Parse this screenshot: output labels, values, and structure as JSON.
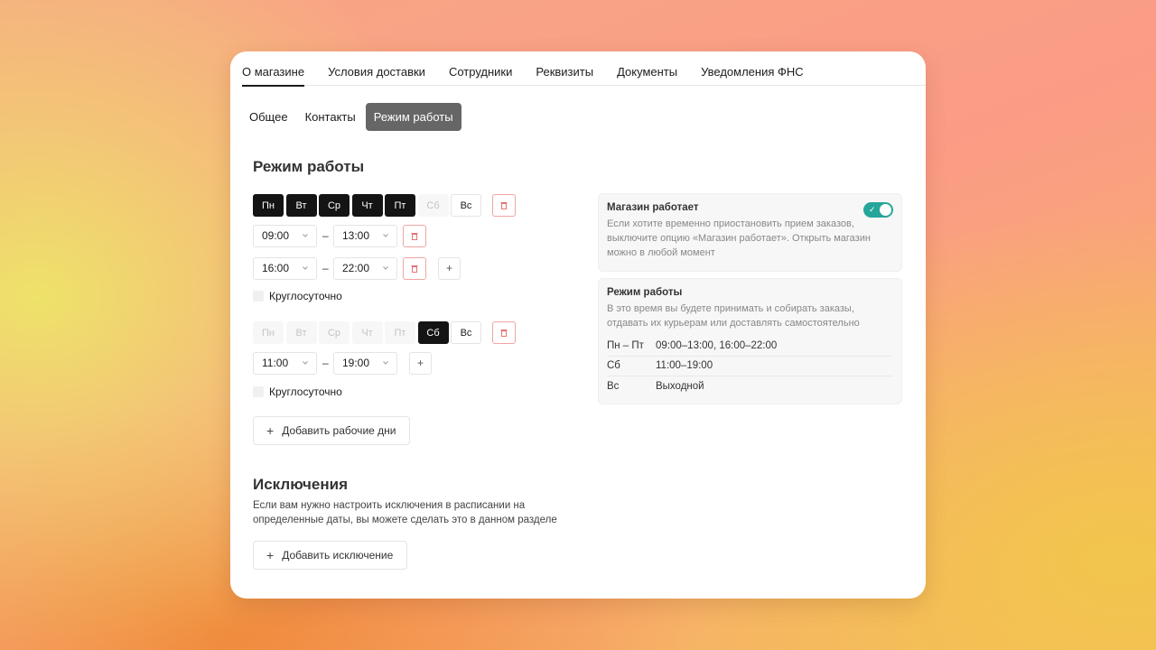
{
  "tabs": [
    "О магазине",
    "Условия доставки",
    "Сотрудники",
    "Реквизиты",
    "Документы",
    "Уведомления ФНС"
  ],
  "subtabs": [
    "Общее",
    "Контакты",
    "Режим работы"
  ],
  "section_title": "Режим работы",
  "group1": {
    "days": [
      "Пн",
      "Вт",
      "Ср",
      "Чт",
      "Пт",
      "Сб",
      "Вс"
    ],
    "intervals": [
      {
        "from": "09:00",
        "to": "13:00"
      },
      {
        "from": "16:00",
        "to": "22:00"
      }
    ],
    "all_day_label": "Круглосуточно"
  },
  "group2": {
    "days": [
      "Пн",
      "Вт",
      "Ср",
      "Чт",
      "Пт",
      "Сб",
      "Вс"
    ],
    "intervals": [
      {
        "from": "11:00",
        "to": "19:00"
      }
    ],
    "all_day_label": "Круглосуточно"
  },
  "dash": "–",
  "plus_symbol": "+",
  "add_days_label": "Добавить рабочие дни",
  "exceptions": {
    "title": "Исключения",
    "description": "Если вам нужно настроить исключения в расписании на определенные даты, вы можете сделать это в данном разделе",
    "add_label": "Добавить исключение"
  },
  "store_status": {
    "title": "Магазин работает",
    "text": "Если хотите временно приостановить прием заказов, выключите опцию «Магазин работает». Открыть магазин можно в любой момент",
    "enabled": true,
    "accent": "#26a69a"
  },
  "schedule_summary": {
    "title": "Режим работы",
    "text": "В это время вы будете принимать и собирать заказы, отдавать их курьерам или доставлять самостоятельно",
    "rows": [
      {
        "day": "Пн – Пт",
        "hours": "09:00–13:00, 16:00–22:00"
      },
      {
        "day": "Сб",
        "hours": "11:00–19:00"
      },
      {
        "day": "Вс",
        "hours": "Выходной"
      }
    ]
  }
}
